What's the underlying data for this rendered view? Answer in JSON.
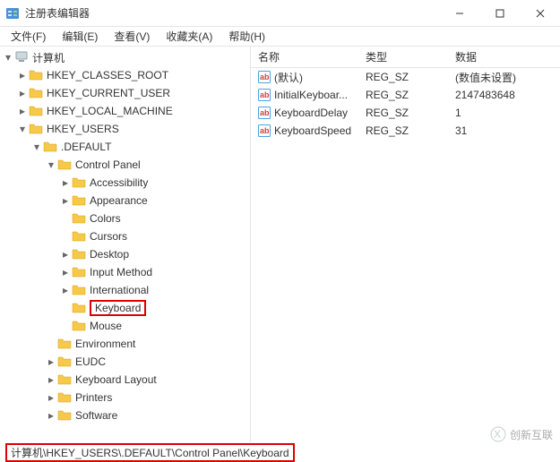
{
  "window": {
    "title": "注册表编辑器"
  },
  "menu": {
    "file": "文件(F)",
    "edit": "编辑(E)",
    "view": "查看(V)",
    "favorites": "收藏夹(A)",
    "help": "帮助(H)"
  },
  "tree": {
    "root": "计算机",
    "items": [
      "HKEY_CLASSES_ROOT",
      "HKEY_CURRENT_USER",
      "HKEY_LOCAL_MACHINE",
      "HKEY_USERS",
      ".DEFAULT",
      "Control Panel",
      "Accessibility",
      "Appearance",
      "Colors",
      "Cursors",
      "Desktop",
      "Input Method",
      "International",
      "Keyboard",
      "Mouse",
      "Environment",
      "EUDC",
      "Keyboard Layout",
      "Printers",
      "Software"
    ]
  },
  "list": {
    "headers": {
      "name": "名称",
      "type": "类型",
      "data": "数据"
    },
    "rows": [
      {
        "name": "(默认)",
        "type": "REG_SZ",
        "data": "(数值未设置)"
      },
      {
        "name": "InitialKeyboar...",
        "type": "REG_SZ",
        "data": "2147483648"
      },
      {
        "name": "KeyboardDelay",
        "type": "REG_SZ",
        "data": "1"
      },
      {
        "name": "KeyboardSpeed",
        "type": "REG_SZ",
        "data": "31"
      }
    ]
  },
  "status": {
    "path": "计算机\\HKEY_USERS\\.DEFAULT\\Control Panel\\Keyboard"
  },
  "watermark": {
    "text": "创新互联"
  }
}
